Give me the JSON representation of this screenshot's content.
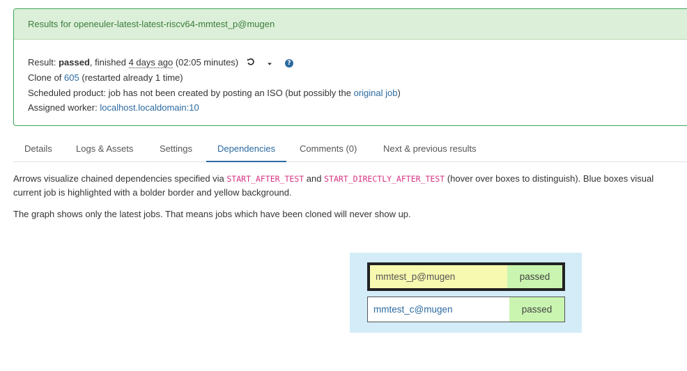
{
  "header": {
    "title": "Results for openeuler-latest-latest-riscv64-mmtest_p@mugen"
  },
  "result": {
    "label": "Result:",
    "status": "passed",
    "finished_label": ", finished",
    "finished_time": "4 days ago",
    "duration": "(02:05 minutes)"
  },
  "clone": {
    "prefix": "Clone of",
    "job_id": "605",
    "suffix": "(restarted already 1 time)"
  },
  "scheduled": {
    "prefix": "Scheduled product: job has not been created by posting an ISO (but possibly the",
    "link": "original job",
    "suffix": ")"
  },
  "worker": {
    "label": "Assigned worker:",
    "value": "localhost.localdomain:10"
  },
  "tabs": [
    {
      "label": "Details"
    },
    {
      "label": "Logs & Assets"
    },
    {
      "label": "Settings"
    },
    {
      "label": "Dependencies"
    },
    {
      "label": "Comments (0)"
    },
    {
      "label": "Next & previous results"
    }
  ],
  "description": {
    "line1_a": "Arrows visualize chained dependencies specified via ",
    "code1": "START_AFTER_TEST",
    "line1_b": " and ",
    "code2": "START_DIRECTLY_AFTER_TEST",
    "line1_c": " (hover over boxes to distinguish). Blue boxes visual",
    "line2": "current job is highlighted with a bolder border and yellow background.",
    "line3": "The graph shows only the latest jobs. That means jobs which have been cloned will never show up."
  },
  "graph": {
    "nodes": [
      {
        "name": "mmtest_p@mugen",
        "result": "passed"
      },
      {
        "name": "mmtest_c@mugen",
        "result": "passed"
      }
    ]
  },
  "colors": {
    "accent": "#2c6aa0",
    "success": "#3fa65b",
    "current_node_bg": "#f7f9b0",
    "passed_bg": "#c9f5b0",
    "graph_bg": "#d3ecf8"
  },
  "icons": {
    "restart": "restart-icon",
    "dropdown": "caret-down-icon",
    "help": "help-icon"
  }
}
